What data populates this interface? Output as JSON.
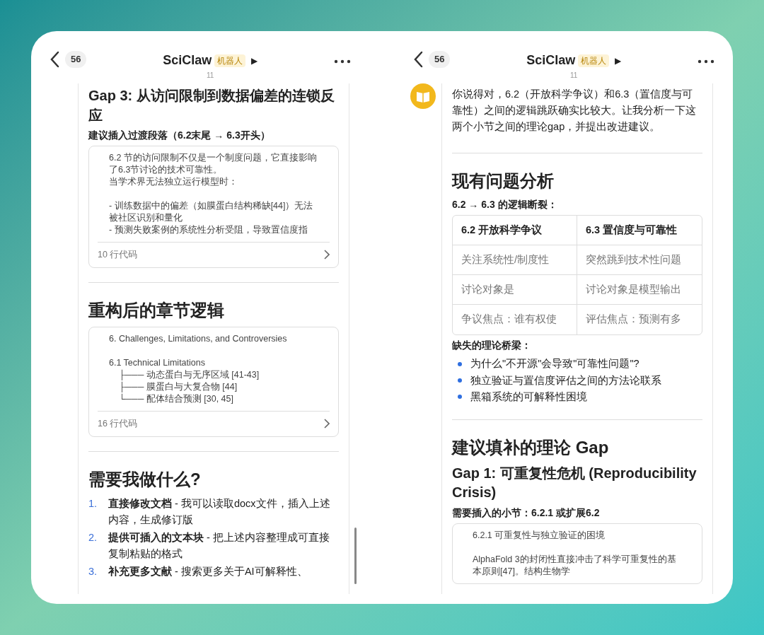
{
  "panels": [
    {
      "header": {
        "count": "56",
        "title": "SciClaw",
        "badge": "机器人",
        "play": "▶",
        "subtitle": "11"
      },
      "blocks": [
        {
          "kind": "h2",
          "text": "Gap 3: 从访问限制到数据偏差的连锁反应"
        },
        {
          "kind": "h4",
          "text": "建议插入过渡段落（6.2末尾 → 6.3开头）"
        },
        {
          "kind": "code",
          "paragraphs": [
            [
              "6.2 节的访问限制不仅是一个制度问题，它直接影响了6.3节讨论的技术可靠性。",
              "当学术界无法独立运行模型时："
            ],
            [
              "- 训练数据中的偏差（如膜蛋白结构稀缺[44]）无法被社区识别和量化",
              "- 预测失败案例的系统性分析受阻，导致置信度指"
            ]
          ],
          "footer": "10 行代码"
        },
        {
          "kind": "divider"
        },
        {
          "kind": "h1",
          "text": "重构后的章节逻辑"
        },
        {
          "kind": "code",
          "paragraphs": [
            [
              "6. Challenges, Limitations, and Controversies"
            ],
            [
              "6.1 Technical Limitations",
              "    ├─── 动态蛋白与无序区域 [41-43]",
              "    ├─── 膜蛋白与大复合物 [44]",
              "    └─── 配体结合预测 [30, 45]"
            ]
          ],
          "footer": "16 行代码"
        },
        {
          "kind": "divider"
        },
        {
          "kind": "h1",
          "text": "需要我做什么?"
        },
        {
          "kind": "olist",
          "items": [
            {
              "marker": "1.",
              "text": "**直接修改文档** - 我可以读取docx文件，插入上述内容，生成修订版"
            },
            {
              "marker": "2.",
              "text": "**提供可插入的文本块** - 把上述内容整理成可直接复制粘贴的格式"
            },
            {
              "marker": "3.",
              "text": "**补充更多文献** - 搜索更多关于AI可解释性、"
            }
          ]
        }
      ]
    },
    {
      "header": {
        "count": "56",
        "title": "SciClaw",
        "badge": "机器人",
        "play": "▶",
        "subtitle": "11"
      },
      "avatar": {
        "kind": "book"
      },
      "blocks": [
        {
          "kind": "p",
          "text": "你说得对，6.2（开放科学争议）和6.3（置信度与可靠性）之间的逻辑跳跃确实比较大。让我分析一下这两个小节之间的理论gap，并提出改进建议。"
        },
        {
          "kind": "divider"
        },
        {
          "kind": "h1",
          "text": "现有问题分析"
        },
        {
          "kind": "h4",
          "text": "6.2 → 6.3 的逻辑断裂："
        },
        {
          "kind": "table",
          "columns": [
            "6.2 开放科学争议",
            "6.3 置信度与可靠性"
          ],
          "rows": [
            [
              "关注系统性/制度性",
              "突然跳到技术性问题"
            ],
            [
              "讨论对象是",
              "讨论对象是模型输出"
            ],
            [
              "争议焦点：谁有权使",
              "评估焦点：预测有多"
            ]
          ]
        },
        {
          "kind": "h4",
          "text": "缺失的理论桥梁："
        },
        {
          "kind": "ulist",
          "items": [
            {
              "text": "为什么\"不开源\"会导致\"可靠性问题\"?"
            },
            {
              "text": "独立验证与置信度评估之间的方法论联系"
            },
            {
              "text": "黑箱系统的可解释性困境"
            }
          ]
        },
        {
          "kind": "divider"
        },
        {
          "kind": "h1",
          "text": "建议填补的理论 Gap"
        },
        {
          "kind": "h2",
          "text": "Gap 1: 可重复性危机 (Reproducibility Crisis)"
        },
        {
          "kind": "h4",
          "text": "需要插入的小节：6.2.1 或扩展6.2"
        },
        {
          "kind": "code",
          "paragraphs": [
            [
              "6.2.1 可重复性与独立验证的困境"
            ],
            [
              "AlphaFold 3的封闭性直接冲击了科学可重复性的基本原则[47]。结构生物学"
            ]
          ]
        }
      ]
    }
  ]
}
